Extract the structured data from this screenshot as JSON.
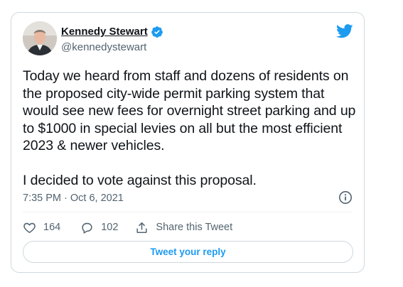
{
  "tweet": {
    "author": {
      "display_name": "Kennedy Stewart",
      "handle": "@kennedystewart",
      "verified": true
    },
    "text": "Today we heard from staff and dozens of residents on the proposed city-wide permit parking system that would see new fees for overnight street parking and up to $1000 in special levies on all but the most efficient 2023 & newer vehicles.\n\nI decided to vote against this proposal.",
    "timestamp": "7:35 PM · Oct 6, 2021",
    "likes": "164",
    "replies": "102",
    "share_label": "Share this Tweet",
    "reply_button_label": "Tweet your reply"
  },
  "colors": {
    "brand_blue": "#1d9bf0",
    "text_primary": "#0f1419",
    "text_secondary": "#536471",
    "border": "#cfd9de"
  },
  "icons": [
    "avatar",
    "verified-badge-icon",
    "twitter-logo-icon",
    "info-icon",
    "heart-icon",
    "reply-icon",
    "share-icon"
  ]
}
